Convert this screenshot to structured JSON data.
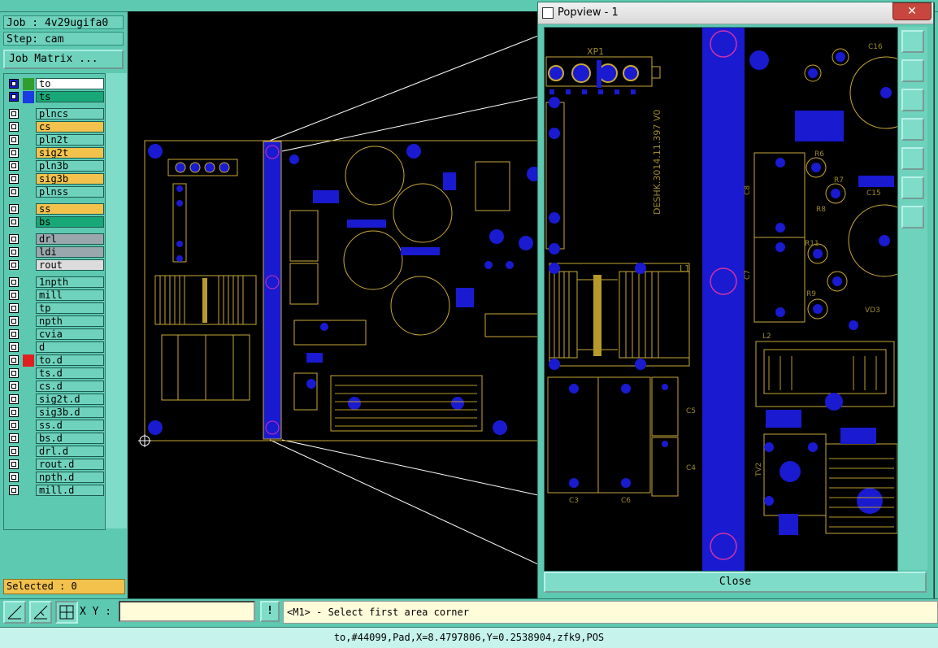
{
  "job": {
    "job_label": "Job : 4v29ugifa0",
    "step_label": "Step: cam",
    "job_matrix_label": "Job Matrix ..."
  },
  "layers": [
    {
      "name": "to",
      "color": "#ffffff",
      "swatch": "#2f9e2f",
      "box": "#1a1ad0"
    },
    {
      "name": "ts",
      "color": "#18a878",
      "swatch": "#1a3be0",
      "box": "#1a1ad0"
    },
    {
      "name": "plncs",
      "color": "#6fd2bc",
      "swatch": "",
      "box": ""
    },
    {
      "name": "cs",
      "color": "#f2c24d",
      "swatch": "",
      "box": ""
    },
    {
      "name": "pln2t",
      "color": "#6fd2bc",
      "swatch": "",
      "box": ""
    },
    {
      "name": "sig2t",
      "color": "#f2c24d",
      "swatch": "",
      "box": ""
    },
    {
      "name": "pln3b",
      "color": "#6fd2bc",
      "swatch": "",
      "box": ""
    },
    {
      "name": "sig3b",
      "color": "#f2c24d",
      "swatch": "",
      "box": ""
    },
    {
      "name": "plnss",
      "color": "#6fd2bc",
      "swatch": "",
      "box": ""
    },
    {
      "name": "ss",
      "color": "#f2c24d",
      "swatch": "",
      "box": ""
    },
    {
      "name": "bs",
      "color": "#18a878",
      "swatch": "",
      "box": ""
    },
    {
      "name": "drl",
      "color": "#9aa7ad",
      "swatch": "",
      "box": ""
    },
    {
      "name": "ldi",
      "color": "#9aa7ad",
      "swatch": "",
      "box": ""
    },
    {
      "name": "rout",
      "color": "#dcdcdc",
      "swatch": "",
      "box": ""
    },
    {
      "name": "1npth",
      "color": "#6fd2bc",
      "swatch": "",
      "box": ""
    },
    {
      "name": "mill",
      "color": "#6fd2bc",
      "swatch": "",
      "box": ""
    },
    {
      "name": "tp",
      "color": "#6fd2bc",
      "swatch": "",
      "box": ""
    },
    {
      "name": "npth",
      "color": "#6fd2bc",
      "swatch": "",
      "box": ""
    },
    {
      "name": "cvia",
      "color": "#6fd2bc",
      "swatch": "",
      "box": ""
    },
    {
      "name": "d",
      "color": "#6fd2bc",
      "swatch": "",
      "box": ""
    },
    {
      "name": "to.d",
      "color": "#6fd2bc",
      "swatch": "#e02020",
      "box": ""
    },
    {
      "name": "ts.d",
      "color": "#6fd2bc",
      "swatch": "",
      "box": ""
    },
    {
      "name": "cs.d",
      "color": "#6fd2bc",
      "swatch": "",
      "box": ""
    },
    {
      "name": "sig2t.d",
      "color": "#6fd2bc",
      "swatch": "",
      "box": ""
    },
    {
      "name": "sig3b.d",
      "color": "#6fd2bc",
      "swatch": "",
      "box": ""
    },
    {
      "name": "ss.d",
      "color": "#6fd2bc",
      "swatch": "",
      "box": ""
    },
    {
      "name": "bs.d",
      "color": "#6fd2bc",
      "swatch": "",
      "box": ""
    },
    {
      "name": "drl.d",
      "color": "#6fd2bc",
      "swatch": "",
      "box": ""
    },
    {
      "name": "rout.d",
      "color": "#6fd2bc",
      "swatch": "",
      "box": ""
    },
    {
      "name": "npth.d",
      "color": "#6fd2bc",
      "swatch": "",
      "box": ""
    },
    {
      "name": "mill.d",
      "color": "#6fd2bc",
      "swatch": "",
      "box": ""
    }
  ],
  "selected_label": "Selected : 0",
  "popup": {
    "title": "Popview - 1",
    "close_label": "Close",
    "close_x": "✕",
    "board_labels": {
      "xp1": "XP1",
      "l1": "L1",
      "l2": "L2",
      "c3": "C3",
      "c6": "C6",
      "c8": "C8",
      "c7": "C7",
      "c5": "C5",
      "c4": "C4",
      "tv2": "TV2",
      "r7": "R7",
      "r8": "R8",
      "r9": "R9",
      "r11": "R11",
      "r6": "R6",
      "c16": "C16",
      "c15": "C15",
      "vd3": "VD3",
      "silk_text": "DESHK.3014.11.397 V0"
    }
  },
  "toolbar": {
    "xy_label": "X Y :",
    "xy_value": "",
    "excl_label": "!",
    "prompt": "<M1> - Select first area corner"
  },
  "status": "to,#44099,Pad,X=8.4797806,Y=0.2538904,zfk9,POS",
  "colors": {
    "pad": "#1a1ad0",
    "silk": "#b89a2a",
    "outline": "#c9a83a",
    "mask": "#cc33aa",
    "accent": "#5dc9b1"
  }
}
